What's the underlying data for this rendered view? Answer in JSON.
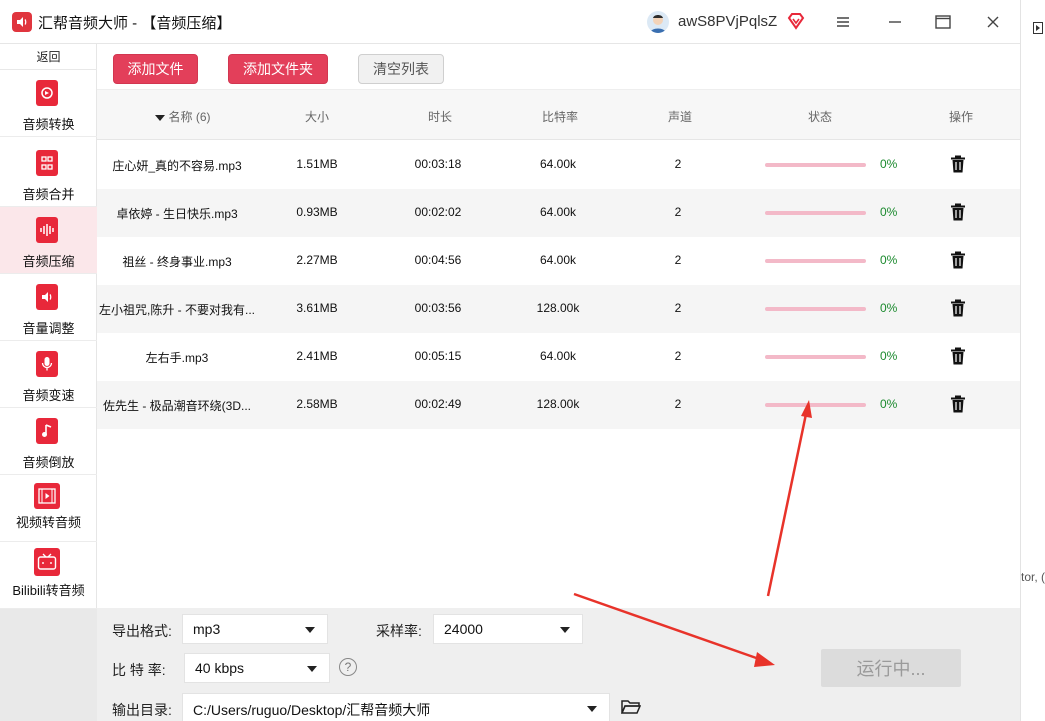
{
  "window": {
    "title": "汇帮音频大师 - 【音频压缩】",
    "username": "awS8PVjPqlsZ",
    "minimize_icon": "hamburger-menu-icon",
    "maximize_icon": "maximize-icon",
    "close_icon": "close-icon"
  },
  "right_strip": {
    "text": "tor, ("
  },
  "sidebar": {
    "back_label": "返回",
    "items": [
      {
        "label": "音频转换",
        "icon": "audio-convert-icon"
      },
      {
        "label": "音频合并",
        "icon": "audio-merge-icon"
      },
      {
        "label": "音频压缩",
        "icon": "audio-compress-icon",
        "active": true
      },
      {
        "label": "音量调整",
        "icon": "volume-icon"
      },
      {
        "label": "音频变速",
        "icon": "microphone-icon"
      },
      {
        "label": "音频倒放",
        "icon": "music-note-icon"
      },
      {
        "label": "视频转音频",
        "icon": "video-film-icon"
      },
      {
        "label": "Bilibili转音频",
        "icon": "bilibili-tv-icon"
      }
    ]
  },
  "toolbar": {
    "add_file_label": "添加文件",
    "add_folder_label": "添加文件夹",
    "clear_list_label": "清空列表"
  },
  "table": {
    "headers": {
      "name": "名称 (6)",
      "size": "大小",
      "duration": "时长",
      "bitrate": "比特率",
      "channels": "声道",
      "status": "状态",
      "actions": "操作"
    },
    "rows": [
      {
        "name": "庄心妍_真的不容易.mp3",
        "size": "1.51MB",
        "duration": "00:03:18",
        "bitrate": "64.00k",
        "channels": "2",
        "progress": "0%"
      },
      {
        "name": "卓依婷 - 生日快乐.mp3",
        "size": "0.93MB",
        "duration": "00:02:02",
        "bitrate": "64.00k",
        "channels": "2",
        "progress": "0%"
      },
      {
        "name": "祖丝 - 终身事业.mp3",
        "size": "2.27MB",
        "duration": "00:04:56",
        "bitrate": "64.00k",
        "channels": "2",
        "progress": "0%"
      },
      {
        "name": "左小祖咒,陈升 - 不要对我有...",
        "size": "3.61MB",
        "duration": "00:03:56",
        "bitrate": "128.00k",
        "channels": "2",
        "progress": "0%"
      },
      {
        "name": "左右手.mp3",
        "size": "2.41MB",
        "duration": "00:05:15",
        "bitrate": "64.00k",
        "channels": "2",
        "progress": "0%"
      },
      {
        "name": "佐先生 - 极品潮音环绕(3D...",
        "size": "2.58MB",
        "duration": "00:02:49",
        "bitrate": "128.00k",
        "channels": "2",
        "progress": "0%"
      }
    ]
  },
  "settings": {
    "format_label": "导出格式:",
    "format_value": "mp3",
    "sample_rate_label": "采样率:",
    "sample_rate_value": "24000",
    "bitrate_label": "比 特 率:",
    "bitrate_value": "40 kbps",
    "help_symbol": "?",
    "output_label": "输出目录:",
    "output_value": "C:/Users/ruguo/Desktop/汇帮音频大师",
    "run_label": "运行中..."
  },
  "colors": {
    "accent": "#e33f5a",
    "progress_track": "#f3b9c8",
    "percent_text": "#1b8a2e",
    "annotation_arrow": "#e8332a"
  }
}
